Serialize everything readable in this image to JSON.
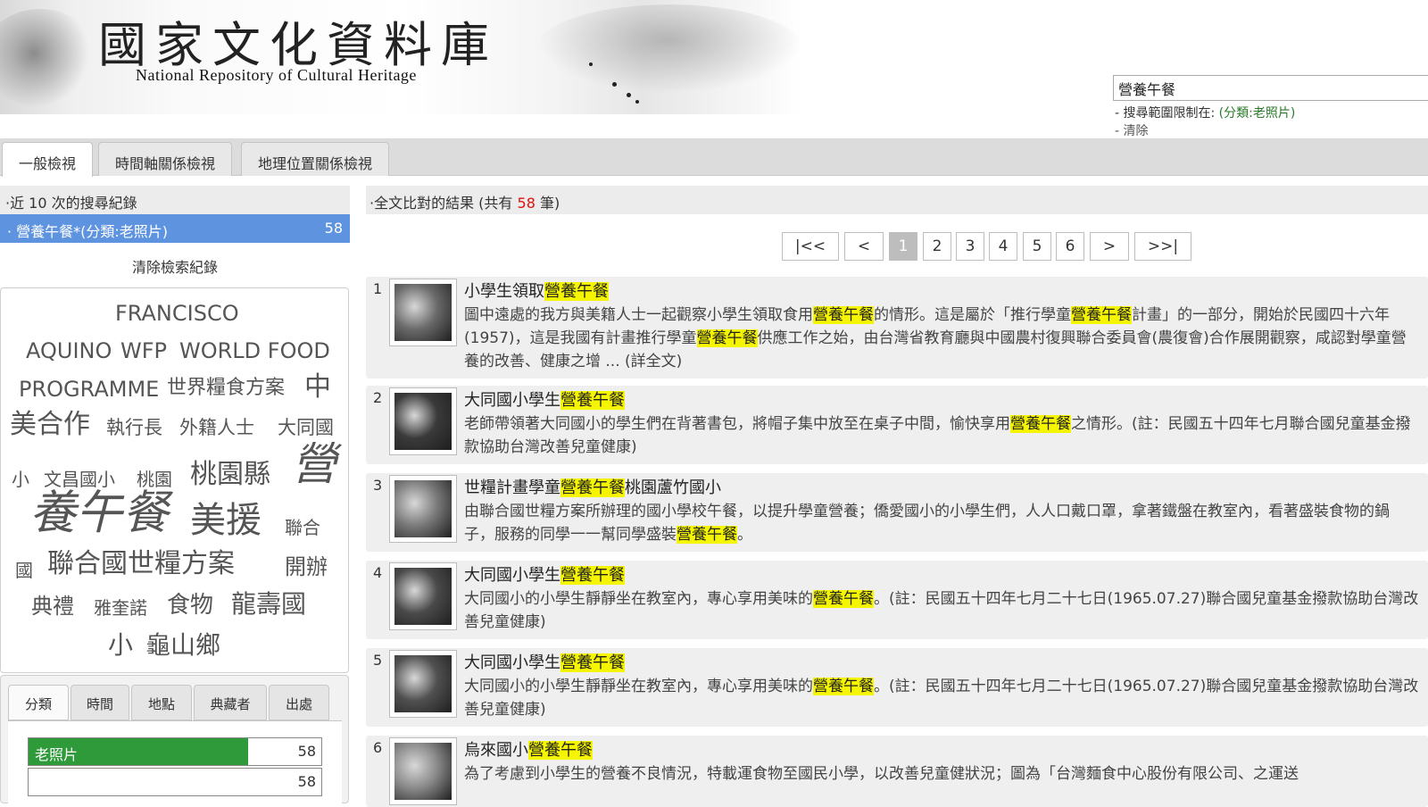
{
  "header": {
    "site_title": "國家文化資料庫",
    "site_subtitle": "National Repository of Cultural Heritage",
    "search_value": "營養午餐",
    "scope_prefix": "- 搜尋範圍限制在: ",
    "scope_value": "(分類:老照片)",
    "clear_label": "- 清除"
  },
  "tabs": [
    "一般檢視",
    "時間軸關係檢視",
    "地理位置關係檢視"
  ],
  "history": {
    "heading": "·近 10 次的搜尋紀錄",
    "item_label": "· 營養午餐*(分類:老照片)",
    "item_count": "58",
    "clear_label": "清除檢索紀錄"
  },
  "tag_cloud": [
    "FRANCISCO",
    "AQUINO",
    "WFP",
    "WORLD FOOD",
    "PROGRAMME",
    "世界糧食方案",
    "中",
    "美合作",
    "執行長",
    "外籍人士",
    "大同國",
    "營",
    "小",
    "文昌國小",
    "桃園",
    "桃園縣",
    "養午餐",
    "美援",
    "聯合",
    "國",
    "聯合國世糧方案",
    "開辦",
    "典禮",
    "雅奎諾",
    "食物",
    "龍壽國",
    "小",
    "龜山鄉"
  ],
  "facets": {
    "tabs": [
      "分類",
      "時間",
      "地點",
      "典藏者",
      "出處"
    ],
    "rows": [
      {
        "label": "老照片",
        "count": "58",
        "fraction": 0.75
      },
      {
        "label": "",
        "count": "58",
        "fraction": 0
      }
    ]
  },
  "results_header": {
    "prefix": "·全文比對的結果 (共有 ",
    "count": "58",
    "suffix": " 筆)"
  },
  "pager": [
    "|<<",
    "<",
    "1",
    "2",
    "3",
    "4",
    "5",
    "6",
    ">",
    ">>|"
  ],
  "results": [
    {
      "index": "1",
      "title_pre": "小學生領取",
      "title_hl": "營養午餐",
      "title_post": "",
      "desc": [
        [
          "圖中遠處的我方與美籍人士一起觀察小學生領取食用",
          false
        ],
        [
          "營養午餐",
          true
        ],
        [
          "的情形。這是屬於「推行學童",
          false
        ],
        [
          "營養午餐",
          true
        ],
        [
          "計畫」的一部分，開始於民國四十六年(1957)，這是我國有計畫推行學童",
          false
        ],
        [
          "營養午餐",
          true
        ],
        [
          "供應工作之始，由台灣省教育廳與中國農村復興聯合委員會(農復會)合作展開觀察，咸認對學童營養的改善、健康之增 ... (詳全文)",
          false
        ]
      ]
    },
    {
      "index": "2",
      "title_pre": "大同國小學生",
      "title_hl": "營養午餐",
      "title_post": "",
      "desc": [
        [
          "老師帶領著大同國小的學生們在背著書包，將帽子集中放至在桌子中間，愉快享用",
          false
        ],
        [
          "營養午餐",
          true
        ],
        [
          "之情形。(註：民國五十四年七月聯合國兒童基金撥款協助台灣改善兒童健康)",
          false
        ]
      ]
    },
    {
      "index": "3",
      "title_pre": "世糧計畫學童",
      "title_hl": "營養午餐",
      "title_post": "桃園蘆竹國小",
      "desc": [
        [
          "由聯合國世糧方案所辦理的國小學校午餐，以提升學童營養；僑愛國小的小學生們，人人口戴口罩，拿著鐵盤在教室內，看著盛裝食物的鍋子，服務的同學一一幫同學盛裝",
          false
        ],
        [
          "營養午餐",
          true
        ],
        [
          "。",
          false
        ]
      ]
    },
    {
      "index": "4",
      "title_pre": "大同國小學生",
      "title_hl": "營養午餐",
      "title_post": "",
      "desc": [
        [
          "大同國小的小學生靜靜坐在教室內，專心享用美味的",
          false
        ],
        [
          "營養午餐",
          true
        ],
        [
          "。(註：民國五十四年七月二十七日(1965.07.27)聯合國兒童基金撥款協助台灣改善兒童健康)",
          false
        ]
      ]
    },
    {
      "index": "5",
      "title_pre": "大同國小學生",
      "title_hl": "營養午餐",
      "title_post": "",
      "desc": [
        [
          "大同國小的小學生靜靜坐在教室內，專心享用美味的",
          false
        ],
        [
          "營養午餐",
          true
        ],
        [
          "。(註：民國五十四年七月二十七日(1965.07.27)聯合國兒童基金撥款協助台灣改善兒童健康)",
          false
        ]
      ]
    },
    {
      "index": "6",
      "title_pre": "烏來國小",
      "title_hl": "營養午餐",
      "title_post": "",
      "desc": [
        [
          "為了考慮到小學生的營養不良情況，特載運食物至國民小學，以改善兒童健狀況；圖為「台灣麵食中心股份有限公司、之運送",
          false
        ]
      ]
    }
  ]
}
